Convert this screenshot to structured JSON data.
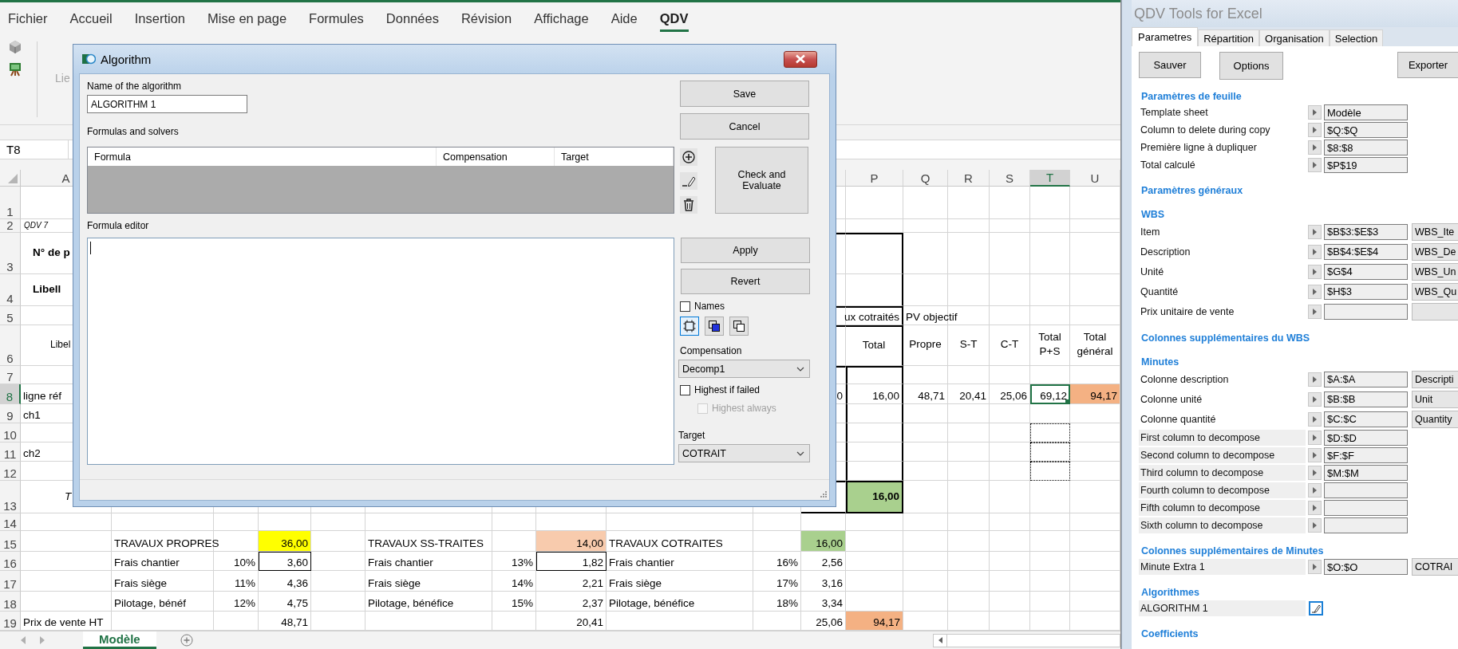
{
  "excel": {
    "ribbon_tabs": [
      {
        "label": "Fichier",
        "selected": false
      },
      {
        "label": "Accueil",
        "selected": false
      },
      {
        "label": "Insertion",
        "selected": false
      },
      {
        "label": "Mise en page",
        "selected": false
      },
      {
        "label": "Formules",
        "selected": false
      },
      {
        "label": "Données",
        "selected": false
      },
      {
        "label": "Révision",
        "selected": false
      },
      {
        "label": "Affichage",
        "selected": false
      },
      {
        "label": "Aide",
        "selected": false
      },
      {
        "label": "QDV",
        "selected": true
      }
    ],
    "ribbon_label": "Lie",
    "name_box": "T8",
    "sheet": {
      "column_headers": {
        "column_a": {
          "label": "A",
          "selected": false
        },
        "column_p": {
          "label": "P",
          "selected": false
        },
        "column_q": {
          "label": "Q",
          "selected": false
        },
        "column_r": {
          "label": "R",
          "selected": false
        },
        "column_s": {
          "label": "S",
          "selected": false
        },
        "column_t": {
          "label": "T",
          "selected": true
        },
        "column_u": {
          "label": "U",
          "selected": false
        }
      },
      "rows": [
        {
          "number": "1",
          "selected": false
        },
        {
          "number": "2",
          "selected": false,
          "cells": {
            "column_a": {
              "text": "QDV 7",
              "kind": "note",
              "selected": false
            }
          }
        },
        {
          "number": "3",
          "selected": false,
          "cells": {
            "column_a": {
              "text": "N° de p",
              "kind": "heading",
              "selected": false
            }
          }
        },
        {
          "number": "4",
          "selected": false,
          "cells": {
            "column_a": {
              "text": "Libell",
              "kind": "heading",
              "selected": false
            }
          }
        },
        {
          "number": "5",
          "selected": false,
          "cells": {
            "column_p": {
              "text": "ux cotraités",
              "kind": "overflow_left",
              "selected": false
            },
            "column_q": {
              "text": "PV objectif",
              "kind": "text",
              "selected": false
            }
          }
        },
        {
          "number": "6",
          "selected": false,
          "cells": {
            "column_a": {
              "text": "Libel",
              "kind": "caption",
              "selected": false
            },
            "column_p": {
              "text": "Total",
              "kind": "center",
              "selected": false
            },
            "column_q": {
              "text": "Propre",
              "kind": "center",
              "selected": false
            },
            "column_r": {
              "text": "S-T",
              "kind": "center",
              "selected": false
            },
            "column_s": {
              "text": "C-T",
              "kind": "center",
              "selected": false
            },
            "column_t": {
              "text": "Total P+S",
              "kind": "center",
              "selected": false
            },
            "column_u": {
              "text": "Total général",
              "kind": "center",
              "selected": false
            }
          }
        },
        {
          "number": "7",
          "selected": false
        },
        {
          "number": "8",
          "selected": true,
          "cells": {
            "column_a": {
              "text": "ligne réf",
              "kind": "text",
              "selected": false
            },
            "column_11": {
              "text": "0",
              "kind": "number",
              "selected": false
            },
            "column_p": {
              "text": "16,00",
              "kind": "number",
              "selected": false
            },
            "column_q": {
              "text": "48,71",
              "kind": "number",
              "selected": false
            },
            "column_r": {
              "text": "20,41",
              "kind": "number",
              "selected": false
            },
            "column_s": {
              "text": "25,06",
              "kind": "number",
              "selected": false
            },
            "column_t": {
              "text": "69,12",
              "kind": "number",
              "selected": true
            },
            "column_u": {
              "text": "94,17",
              "kind": "number",
              "selected": false,
              "color": "#f4b183"
            }
          }
        },
        {
          "number": "9",
          "selected": false,
          "cells": {
            "column_a": {
              "text": "ch1",
              "kind": "text",
              "selected": false
            }
          }
        },
        {
          "number": "10",
          "selected": false,
          "cells": {
            "column_t": {
              "kind": "marquee",
              "selected": false
            }
          }
        },
        {
          "number": "11",
          "selected": false,
          "cells": {
            "column_a": {
              "text": "ch2",
              "kind": "text",
              "selected": false
            },
            "column_t": {
              "kind": "marquee",
              "selected": false
            }
          }
        },
        {
          "number": "12",
          "selected": false,
          "cells": {
            "column_t": {
              "kind": "marquee",
              "selected": false
            }
          }
        },
        {
          "number": "13",
          "selected": false,
          "cells": {
            "column_a": {
              "text": "T",
              "kind": "italic",
              "selected": false
            },
            "column_p": {
              "text": "16,00",
              "kind": "bold_number",
              "selected": false,
              "color": "#a9d08e"
            }
          }
        },
        {
          "number": "14",
          "selected": false
        },
        {
          "number": "15",
          "selected": false,
          "cells": {
            "column_2": {
              "text": "TRAVAUX PROPRES",
              "kind": "text",
              "selected": false
            },
            "column_4": {
              "text": "36,00",
              "kind": "number",
              "selected": false,
              "color": "#ffff00"
            },
            "column_6": {
              "text": "TRAVAUX SS-TRAITES",
              "kind": "text",
              "selected": false
            },
            "column_8": {
              "text": "14,00",
              "kind": "number",
              "selected": false,
              "color": "#f8cbad"
            },
            "column_9": {
              "text": "TRAVAUX COTRAITES",
              "kind": "text",
              "selected": false
            },
            "column_11": {
              "text": "16,00",
              "kind": "number",
              "selected": false,
              "color": "#a9d08e"
            }
          }
        },
        {
          "number": "16",
          "selected": false,
          "cells": {
            "column_2": {
              "text": "Frais chantier",
              "kind": "text",
              "selected": false
            },
            "column_3": {
              "text": "10%",
              "kind": "number",
              "selected": false
            },
            "column_4": {
              "text": "3,60",
              "kind": "number",
              "selected": false
            },
            "column_6": {
              "text": "Frais chantier",
              "kind": "text",
              "selected": false
            },
            "column_7": {
              "text": "13%",
              "kind": "number",
              "selected": false
            },
            "column_8": {
              "text": "1,82",
              "kind": "number",
              "selected": false
            },
            "column_9": {
              "text": "Frais chantier",
              "kind": "text",
              "selected": false
            },
            "column_10": {
              "text": "16%",
              "kind": "number",
              "selected": false
            },
            "column_11": {
              "text": "2,56",
              "kind": "number",
              "selected": false
            }
          }
        },
        {
          "number": "17",
          "selected": false,
          "cells": {
            "column_2": {
              "text": "Frais siège",
              "kind": "text",
              "selected": false
            },
            "column_3": {
              "text": "11%",
              "kind": "number",
              "selected": false
            },
            "column_4": {
              "text": "4,36",
              "kind": "number",
              "selected": false
            },
            "column_6": {
              "text": "Frais siège",
              "kind": "text",
              "selected": false
            },
            "column_7": {
              "text": "14%",
              "kind": "number",
              "selected": false
            },
            "column_8": {
              "text": "2,21",
              "kind": "number",
              "selected": false
            },
            "column_9": {
              "text": "Frais siège",
              "kind": "text",
              "selected": false
            },
            "column_10": {
              "text": "17%",
              "kind": "number",
              "selected": false
            },
            "column_11": {
              "text": "3,16",
              "kind": "number",
              "selected": false
            }
          }
        },
        {
          "number": "18",
          "selected": false,
          "cells": {
            "column_2": {
              "text": "Pilotage, bénéf",
              "kind": "text",
              "selected": false
            },
            "column_3": {
              "text": "12%",
              "kind": "number",
              "selected": false
            },
            "column_4": {
              "text": "4,75",
              "kind": "number",
              "selected": false
            },
            "column_6": {
              "text": "Pilotage, bénéfice",
              "kind": "text",
              "selected": false
            },
            "column_7": {
              "text": "15%",
              "kind": "number",
              "selected": false
            },
            "column_8": {
              "text": "2,37",
              "kind": "number",
              "selected": false
            },
            "column_9": {
              "text": "Pilotage, bénéfice",
              "kind": "text",
              "selected": false
            },
            "column_10": {
              "text": "18%",
              "kind": "number",
              "selected": false
            },
            "column_11": {
              "text": "3,34",
              "kind": "number",
              "selected": false
            }
          }
        },
        {
          "number": "19",
          "selected": false,
          "cells": {
            "column_a": {
              "text": "Prix de vente HT",
              "kind": "text",
              "selected": false
            },
            "column_4": {
              "text": "48,71",
              "kind": "number",
              "selected": false
            },
            "column_8": {
              "text": "20,41",
              "kind": "number",
              "selected": false
            },
            "column_11": {
              "text": "25,06",
              "kind": "number",
              "selected": false
            },
            "column_p": {
              "text": "94,17",
              "kind": "number",
              "selected": false,
              "color": "#f4b183"
            }
          }
        }
      ]
    },
    "sheet_tabs": [
      {
        "label": "Modèle",
        "selected": true
      }
    ]
  },
  "dialog": {
    "title": "Algorithm",
    "name_label": "Name of the algorithm",
    "name_value": "ALGORITHM 1",
    "save_button": "Save",
    "cancel_button": "Cancel",
    "formulas_label": "Formulas and solvers",
    "formula_columns": [
      "Formula",
      "Compensation",
      "Target"
    ],
    "check_button": "Check and Evaluate",
    "editor_label": "Formula editor",
    "editor_focused": true,
    "apply_button": "Apply",
    "revert_button": "Revert",
    "names": {
      "label": "Names",
      "checked": false
    },
    "view_modes": [
      {
        "kind": "select",
        "selected": true
      },
      {
        "kind": "front",
        "selected": false
      },
      {
        "kind": "copy",
        "selected": false
      }
    ],
    "compensation": {
      "label": "Compensation",
      "value": "Decomp1"
    },
    "highest_if_failed": {
      "label": "Highest if failed",
      "checked": false,
      "disabled": false
    },
    "highest_always": {
      "label": "Highest always",
      "checked": false,
      "disabled": true
    },
    "target": {
      "label": "Target",
      "value": "COTRAIT"
    }
  },
  "task_pane": {
    "title": "QDV Tools for Excel",
    "tabs": [
      {
        "label": "Parametres",
        "selected": true
      },
      {
        "label": "Répartition",
        "selected": false
      },
      {
        "label": "Organisation",
        "selected": false
      },
      {
        "label": "Selection",
        "selected": false
      }
    ],
    "buttons": [
      "Sauver",
      "Options",
      "Exporter"
    ],
    "sections": [
      {
        "title": "Paramètres de feuille",
        "rows": [
          {
            "kind": "field",
            "label": "Template sheet",
            "value": "Modèle"
          },
          {
            "kind": "field",
            "label": "Column to delete during copy",
            "value": "$Q:$Q"
          },
          {
            "kind": "field",
            "label": "Première ligne à dupliquer",
            "value": "$8:$8"
          },
          {
            "kind": "field",
            "label": "Total calculé",
            "value": "$P$19"
          }
        ]
      },
      {
        "title": "Paramètres généraux"
      },
      {
        "title": "WBS",
        "rows": [
          {
            "kind": "field_pair",
            "label": "Item",
            "value": "$B$3:$E$3",
            "extra": "WBS_Ite"
          },
          {
            "kind": "field_pair",
            "label": "Description",
            "value": "$B$4:$E$4",
            "extra": "WBS_De"
          },
          {
            "kind": "field_pair",
            "label": "Unité",
            "value": "$G$4",
            "extra": "WBS_Un"
          },
          {
            "kind": "field_pair",
            "label": "Quantité",
            "value": "$H$3",
            "extra": "WBS_Qu"
          },
          {
            "kind": "field_pair",
            "label": "Prix unitaire de vente"
          }
        ]
      },
      {
        "title": "Colonnes supplémentaires du WBS"
      },
      {
        "title": "Minutes",
        "rows": [
          {
            "kind": "field_pair",
            "label": "Colonne description",
            "value": "$A:$A",
            "extra": "Descripti"
          },
          {
            "kind": "field_pair",
            "label": "Colonne unité",
            "value": "$B:$B",
            "extra": "Unit"
          },
          {
            "kind": "field_pair",
            "label": "Colonne quantité",
            "value": "$C:$C",
            "extra": "Quantity"
          },
          {
            "kind": "shaded_field",
            "label": "First column to decompose",
            "value": "$D:$D"
          },
          {
            "kind": "shaded_field",
            "label": "Second column to decompose",
            "value": "$F:$F"
          },
          {
            "kind": "shaded_field",
            "label": "Third column to decompose",
            "value": "$M:$M"
          },
          {
            "kind": "shaded_field",
            "label": "Fourth column to decompose"
          },
          {
            "kind": "shaded_field",
            "label": "Fifth column to decompose"
          },
          {
            "kind": "shaded_field",
            "label": "Sixth column to decompose"
          }
        ]
      },
      {
        "title": "Colonnes supplémentaires de Minutes",
        "rows": [
          {
            "kind": "shaded_pair",
            "label": "Minute Extra 1",
            "value": "$O:$O",
            "extra": "COTRAI"
          }
        ]
      },
      {
        "title": "Algorithmes",
        "rows": [
          {
            "kind": "algorithm",
            "label": "ALGORITHM 1"
          }
        ]
      },
      {
        "title": "Coefficients"
      }
    ]
  }
}
